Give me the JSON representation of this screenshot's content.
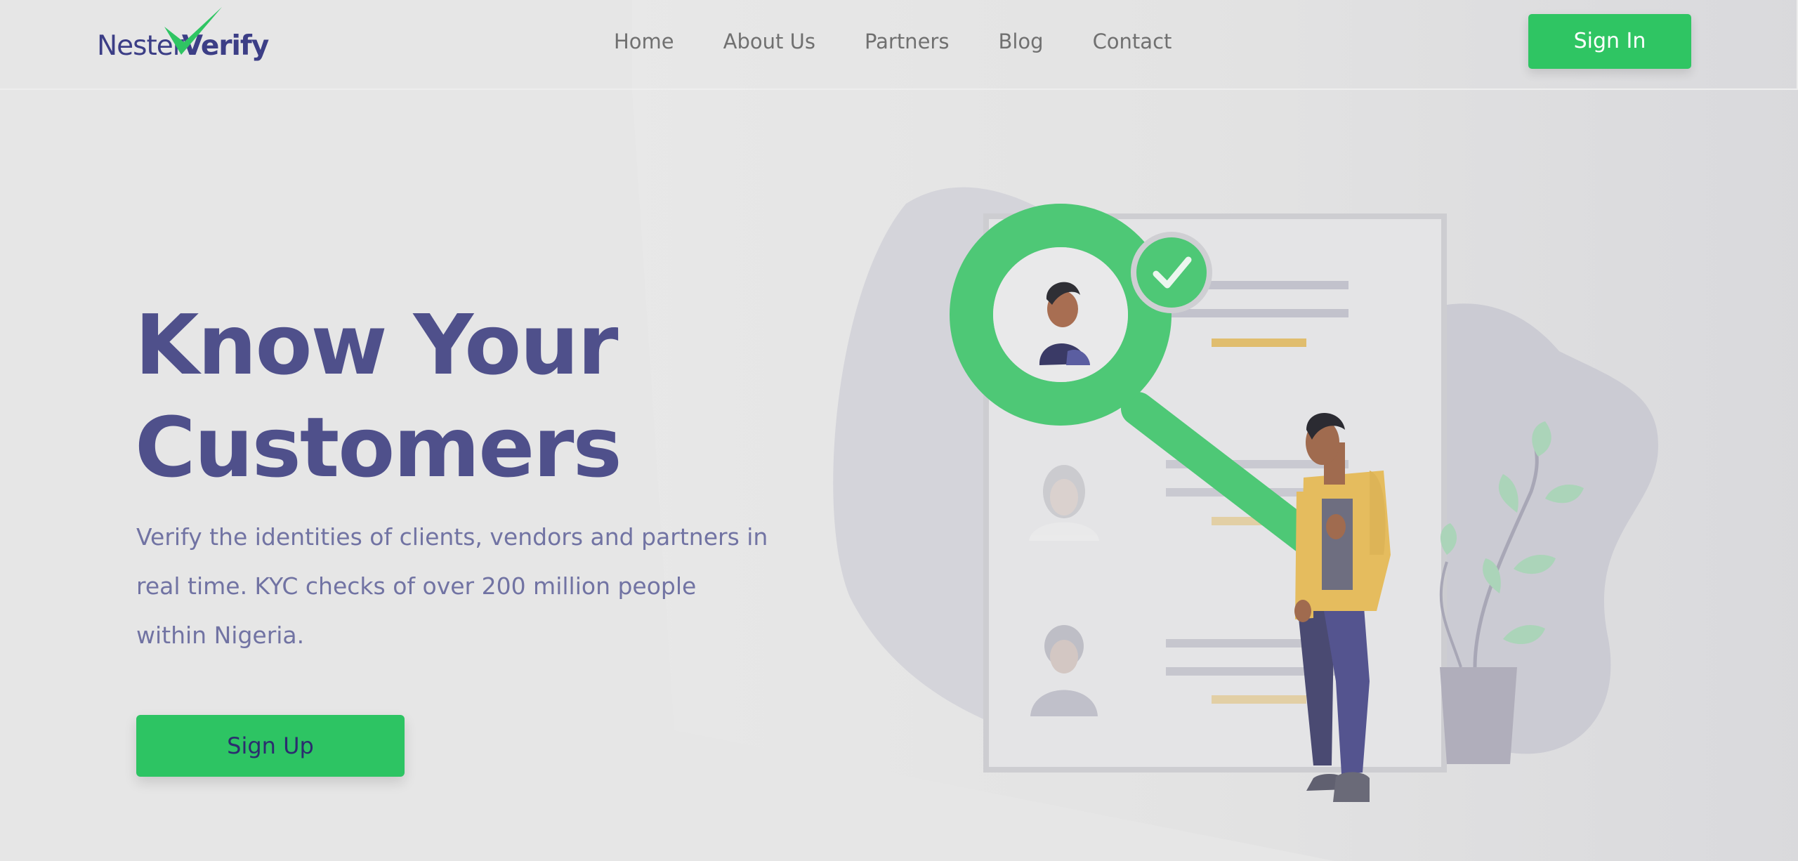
{
  "brand": {
    "name_part1": "Nester",
    "name_part2": "Verify",
    "accent_green": "#2fc563",
    "accent_navy": "#4f508b"
  },
  "nav": {
    "links": [
      "Home",
      "About Us",
      "Partners",
      "Blog",
      "Contact"
    ],
    "signin_label": "Sign In"
  },
  "hero": {
    "title_line1": "Know Your",
    "title_line2": "Customers",
    "description": "Verify the identities of clients, vendors and partners in real time. KYC checks of over 200 million people within Nigeria.",
    "signup_label": "Sign Up"
  },
  "illustration": {
    "icons": [
      "magnifier-icon",
      "check-icon",
      "person-icon",
      "plant-icon"
    ]
  }
}
